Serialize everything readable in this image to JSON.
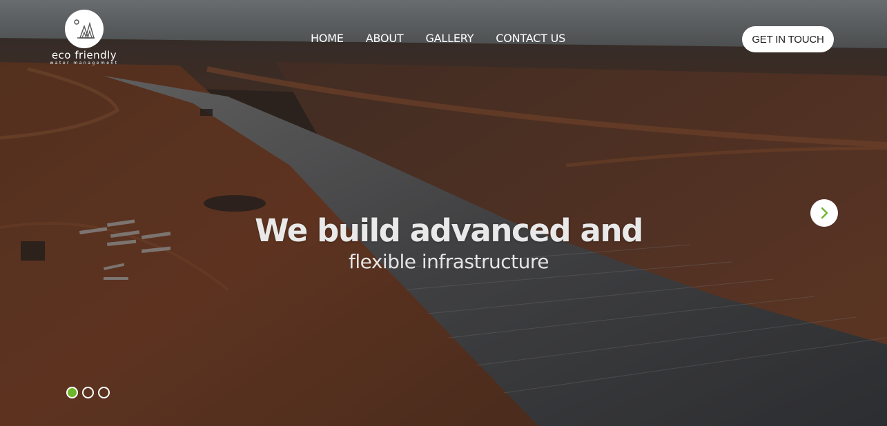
{
  "brand": {
    "name": "eco friendly",
    "tagline": "water management",
    "logo_icon": "pine-trees-icon"
  },
  "nav": {
    "items": [
      {
        "label": "HOME"
      },
      {
        "label": "ABOUT"
      },
      {
        "label": "GALLERY"
      },
      {
        "label": "CONTACT US"
      }
    ]
  },
  "cta": {
    "label": "GET IN TOUCH"
  },
  "hero": {
    "headline": "We build advanced and",
    "subheadline": "flexible infrastructure",
    "background": "aerial-canal-construction-image",
    "next_icon": "chevron-right-icon"
  },
  "slider": {
    "total_slides": 3,
    "active_slide": 1
  },
  "colors": {
    "accent": "#6db52b",
    "nav_text": "#ffffff",
    "headline": "#e9e9e9"
  }
}
